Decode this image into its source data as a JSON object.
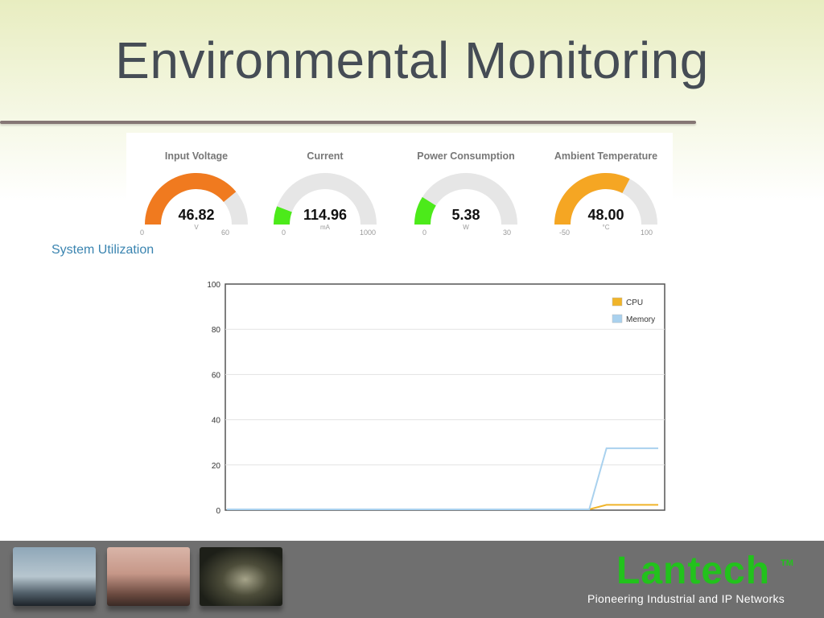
{
  "slide": {
    "title": "Environmental Monitoring"
  },
  "gauges": [
    {
      "title": "Input Voltage",
      "value": "46.82",
      "unit": "V",
      "min": "0",
      "max": "60",
      "color": "#f07a1f",
      "fraction": 0.78
    },
    {
      "title": "Current",
      "value": "114.96",
      "unit": "mA",
      "min": "0",
      "max": "1000",
      "color": "#4cea1a",
      "fraction": 0.115
    },
    {
      "title": "Power Consumption",
      "value": "5.38",
      "unit": "W",
      "min": "0",
      "max": "30",
      "color": "#4cea1a",
      "fraction": 0.179
    },
    {
      "title": "Ambient Temperature",
      "value": "48.00",
      "unit": "°C",
      "min": "-50",
      "max": "100",
      "color": "#f5a623",
      "fraction": 0.653
    }
  ],
  "system_utilization": {
    "title": "System Utilization"
  },
  "chart_data": {
    "type": "line",
    "title": "",
    "xlabel": "",
    "ylabel": "",
    "ylim": [
      0,
      100
    ],
    "yticks": [
      "0",
      "20",
      "40",
      "60",
      "80",
      "100"
    ],
    "grid": true,
    "legend_position": "top-right",
    "x": [
      0,
      1,
      2,
      3,
      4,
      5,
      6,
      7,
      8,
      9,
      10,
      11,
      12,
      13,
      14,
      15,
      16,
      17,
      18,
      19,
      20,
      21,
      22,
      23,
      24,
      25
    ],
    "series": [
      {
        "name": "CPU",
        "color": "#f0b429",
        "values": [
          0,
          0,
          0,
          0,
          0,
          0,
          0,
          0,
          0,
          0,
          0,
          0,
          0,
          0,
          0,
          0,
          0,
          0,
          0,
          0,
          0,
          0,
          2,
          2,
          2,
          2
        ]
      },
      {
        "name": "Memory",
        "color": "#a9d1ee",
        "values": [
          0,
          0,
          0,
          0,
          0,
          0,
          0,
          0,
          0,
          0,
          0,
          0,
          0,
          0,
          0,
          0,
          0,
          0,
          0,
          0,
          0,
          0,
          27,
          27,
          27,
          27
        ]
      }
    ]
  },
  "footer": {
    "logo_text": "Lantech",
    "logo_tm": "TM",
    "tagline": "Pioneering Industrial and IP Networks",
    "thumbnails": [
      "ship-port-photo",
      "industrial-plant-photo",
      "tunnel-traffic-photo"
    ]
  }
}
